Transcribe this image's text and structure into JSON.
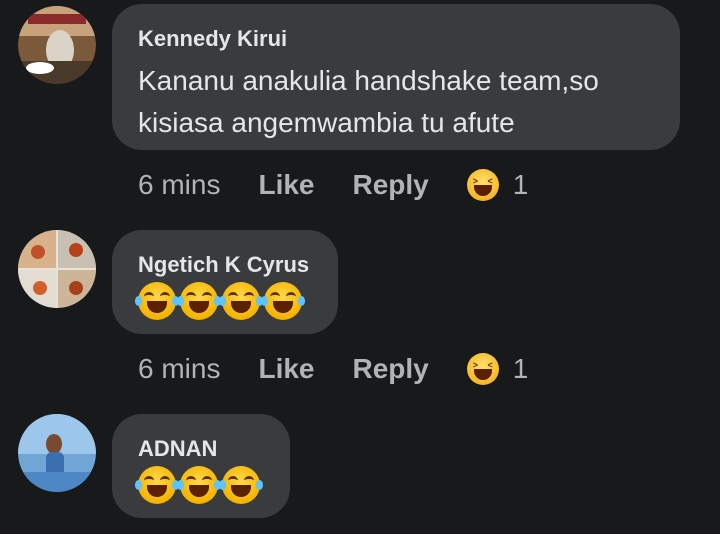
{
  "comments": [
    {
      "author": "Kennedy Kirui",
      "text": "Kananu anakulia handshake team,so kisiasa angemwambia tu afute",
      "emoji_count": 0,
      "time": "6 mins",
      "like_label": "Like",
      "reply_label": "Reply",
      "reaction_icon": "laughing-reaction-icon",
      "reaction_count": "1"
    },
    {
      "author": "Ngetich K Cyrus",
      "text": "",
      "emoji_count": 4,
      "time": "6 mins",
      "like_label": "Like",
      "reply_label": "Reply",
      "reaction_icon": "laughing-reaction-icon",
      "reaction_count": "1"
    },
    {
      "author": "ADNAN",
      "text": "",
      "emoji_count": 3
    }
  ],
  "colors": {
    "background": "#18191a",
    "bubble": "#3a3b3c",
    "primary_text": "#e4e6eb",
    "secondary_text": "#b0b3b8",
    "emoji_yellow": "#f7b928"
  }
}
